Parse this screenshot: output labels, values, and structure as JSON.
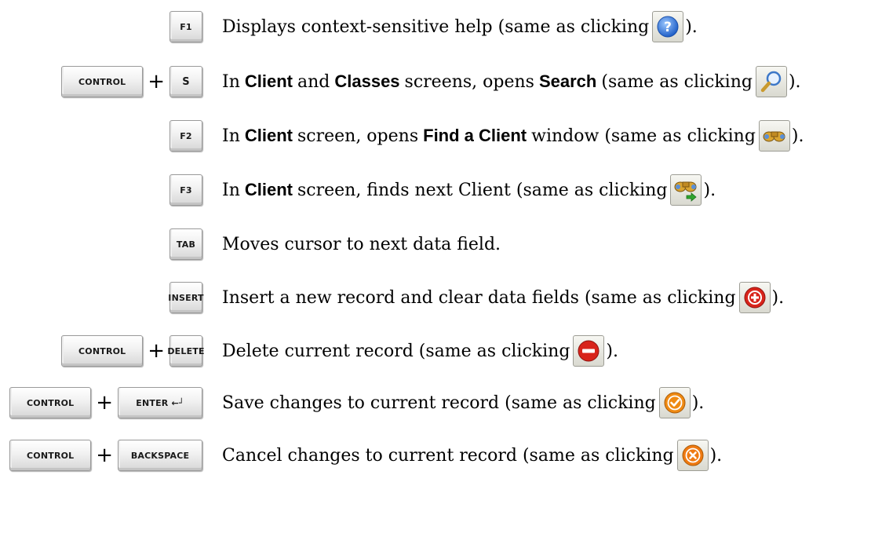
{
  "shortcuts": [
    {
      "keys": [
        "F1"
      ],
      "pre": "Displays context-sensitive help (same as clicking",
      "icon": "help-icon",
      "post": ")."
    },
    {
      "keys": [
        "CONTROL",
        "S"
      ],
      "pre": "In",
      "b1": "Client",
      "mid1": "and",
      "b2": "Classes",
      "mid2": "screens, opens",
      "b3": "Search",
      "tail": "(same as clicking",
      "icon": "magnifier-icon",
      "post": ")."
    },
    {
      "keys": [
        "F2"
      ],
      "pre": "In",
      "b1": "Client",
      "mid1": "screen, opens",
      "b2": "Find a Client",
      "tail": "window (same as clicking",
      "icon": "binoculars-icon",
      "post": ")."
    },
    {
      "keys": [
        "F3"
      ],
      "pre": "In",
      "b1": "Client",
      "tail": "screen, finds next Client (same as clicking",
      "icon": "binoculars-next-icon",
      "post": ")."
    },
    {
      "keys": [
        "TAB"
      ],
      "pre": "Moves cursor to next data field."
    },
    {
      "keys": [
        "INSERT"
      ],
      "pre": "Insert a new record and clear data fields (same as clicking",
      "icon": "insert-record-icon",
      "post": ")."
    },
    {
      "keys": [
        "CONTROL",
        "DELETE"
      ],
      "pre": "Delete current record (same as clicking",
      "icon": "delete-record-icon",
      "post": ")."
    },
    {
      "keys": [
        "CONTROL",
        "ENTER ←┘"
      ],
      "pre": "Save changes to current record (same as clicking",
      "icon": "save-record-icon",
      "post": ")."
    },
    {
      "keys": [
        "CONTROL",
        "BACKSPACE"
      ],
      "pre": "Cancel changes to current record (same as clicking",
      "icon": "cancel-record-icon",
      "post": ")."
    }
  ],
  "plus_sign": "+",
  "colors": {
    "help_blue": "#2c6fd1",
    "insert_red": "#d8241b",
    "delete_red": "#d8241b",
    "save_orange": "#ef8a12",
    "cancel_orange": "#ef7a12",
    "binocular_gold": "#d9a431"
  }
}
